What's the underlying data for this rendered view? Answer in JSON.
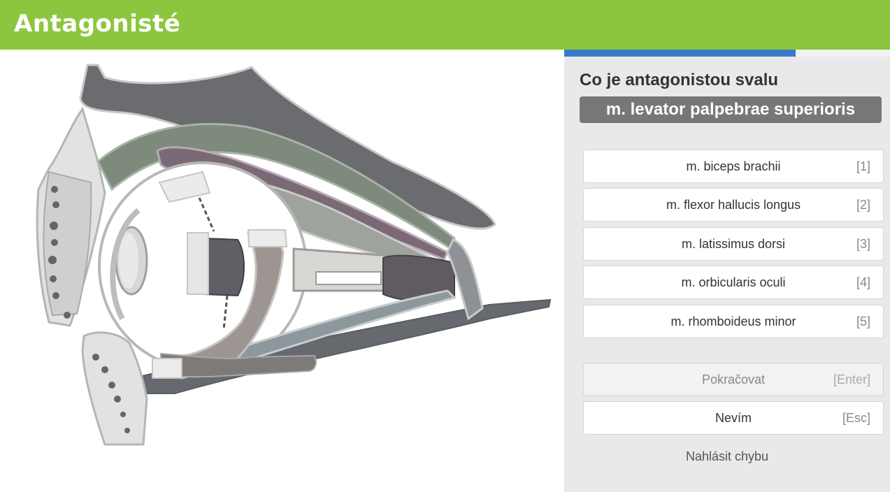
{
  "header": {
    "logo_text": "Antagonisté"
  },
  "progress": {
    "value": 0.71,
    "color": "#3a7bc8"
  },
  "quiz": {
    "question": "Co je antagonistou svalu",
    "term": "m. levator palpebrae superioris",
    "options": [
      {
        "label": "m. biceps brachii",
        "key": "[1]"
      },
      {
        "label": "m. flexor hallucis longus",
        "key": "[2]"
      },
      {
        "label": "m. latissimus dorsi",
        "key": "[3]"
      },
      {
        "label": "m. orbicularis oculi",
        "key": "[4]"
      },
      {
        "label": "m. rhomboideus minor",
        "key": "[5]"
      }
    ],
    "continue": {
      "label": "Pokračovat",
      "key": "[Enter]"
    },
    "dont_know": {
      "label": "Nevím",
      "key": "[Esc]"
    },
    "report_label": "Nahlásit chybu"
  },
  "colors": {
    "header": "#8cc63f",
    "panel": "#e8e9ea",
    "term_bg": "#777777"
  }
}
